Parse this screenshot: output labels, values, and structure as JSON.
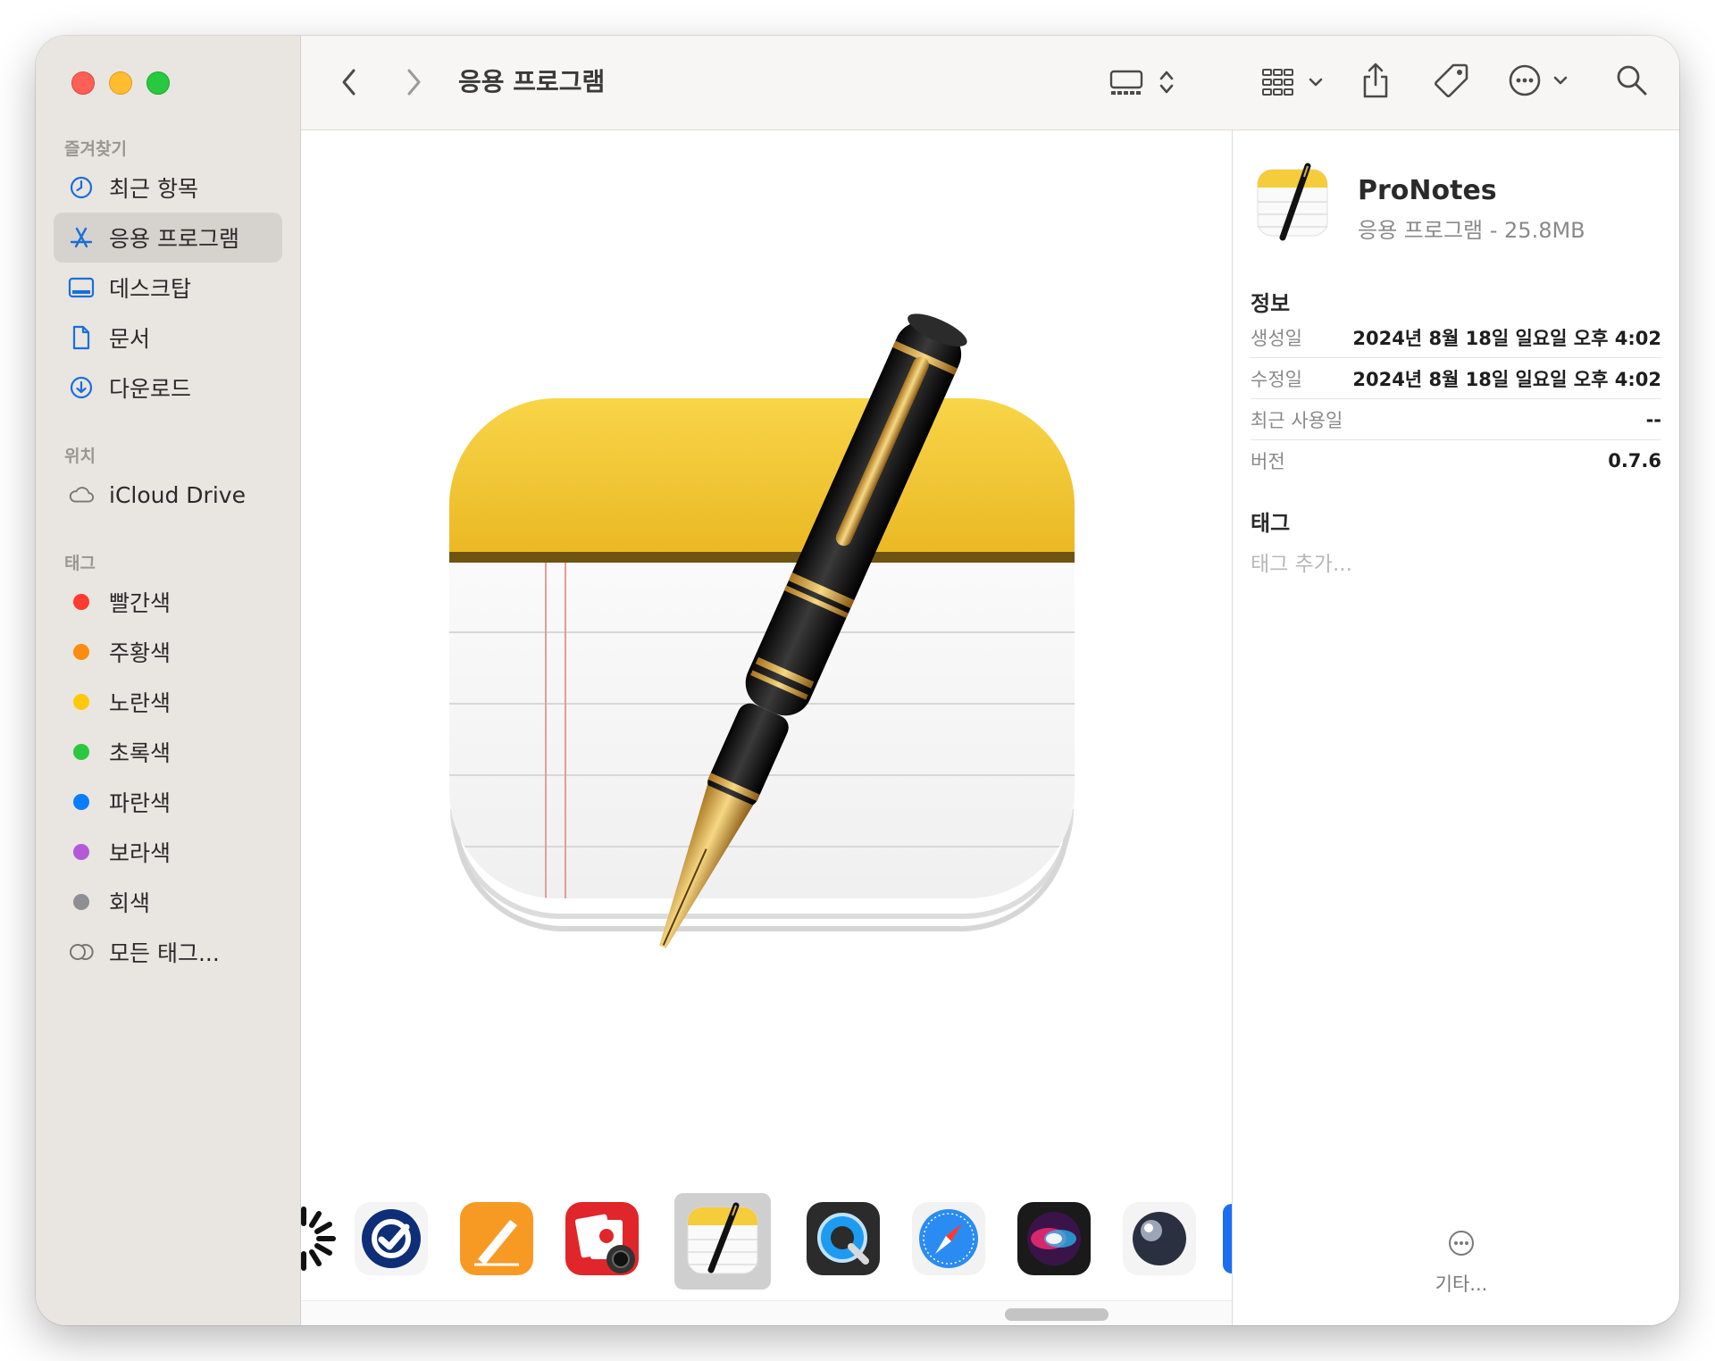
{
  "window": {
    "title": "응용 프로그램"
  },
  "sidebar": {
    "favorites_heading": "즐겨찾기",
    "favorites": [
      {
        "label": "최근 항목",
        "icon": "clock-icon"
      },
      {
        "label": "응용 프로그램",
        "icon": "applications-icon",
        "selected": true
      },
      {
        "label": "데스크탑",
        "icon": "desktop-icon"
      },
      {
        "label": "문서",
        "icon": "document-icon"
      },
      {
        "label": "다운로드",
        "icon": "download-icon"
      }
    ],
    "locations_heading": "위치",
    "locations": [
      {
        "label": "iCloud Drive",
        "icon": "cloud-icon"
      }
    ],
    "tags_heading": "태그",
    "tags": [
      {
        "label": "빨간색",
        "color": "#fe3b30"
      },
      {
        "label": "주황색",
        "color": "#fe8c10"
      },
      {
        "label": "노란색",
        "color": "#fdc90b"
      },
      {
        "label": "초록색",
        "color": "#2ac840"
      },
      {
        "label": "파란색",
        "color": "#0a7cff"
      },
      {
        "label": "보라색",
        "color": "#b35bd6"
      },
      {
        "label": "회색",
        "color": "#8e8e93"
      }
    ],
    "all_tags": "모든 태그..."
  },
  "toolbar": {
    "back_icon": "chevron-left-icon",
    "forward_icon": "chevron-right-icon",
    "view_icon": "gallery-view-icon",
    "group_icon": "group-grid-icon",
    "share_icon": "share-icon",
    "tag_icon": "tag-icon",
    "action_icon": "ellipsis-circle-icon",
    "search_icon": "search-icon"
  },
  "inspector": {
    "app_name": "ProNotes",
    "app_subtitle": "응용 프로그램 - 25.8MB",
    "info_heading": "정보",
    "info": [
      {
        "key": "생성일",
        "value": "2024년 8월 18일 일요일 오후 4:02"
      },
      {
        "key": "수정일",
        "value": "2024년 8월 18일 일요일 오후 4:02"
      },
      {
        "key": "최근 사용일",
        "value": "--"
      },
      {
        "key": "버전",
        "value": "0.7.6"
      }
    ],
    "tags_heading": "태그",
    "tags_placeholder": "태그 추가...",
    "more_label": "기타..."
  },
  "strip": {
    "items": [
      "activity-app-icon",
      "omnifocus-app-icon",
      "pages-app-icon",
      "photo-booth-app-icon",
      "pronotes-app-icon",
      "quicktime-app-icon",
      "safari-app-icon",
      "siri-app-icon",
      "marble-app-icon",
      "partial-app-icon"
    ],
    "selected": "pronotes-app-icon"
  },
  "colors": {
    "sidebar_bg": "#e9e5e1",
    "accent": "#1a6fd8"
  }
}
